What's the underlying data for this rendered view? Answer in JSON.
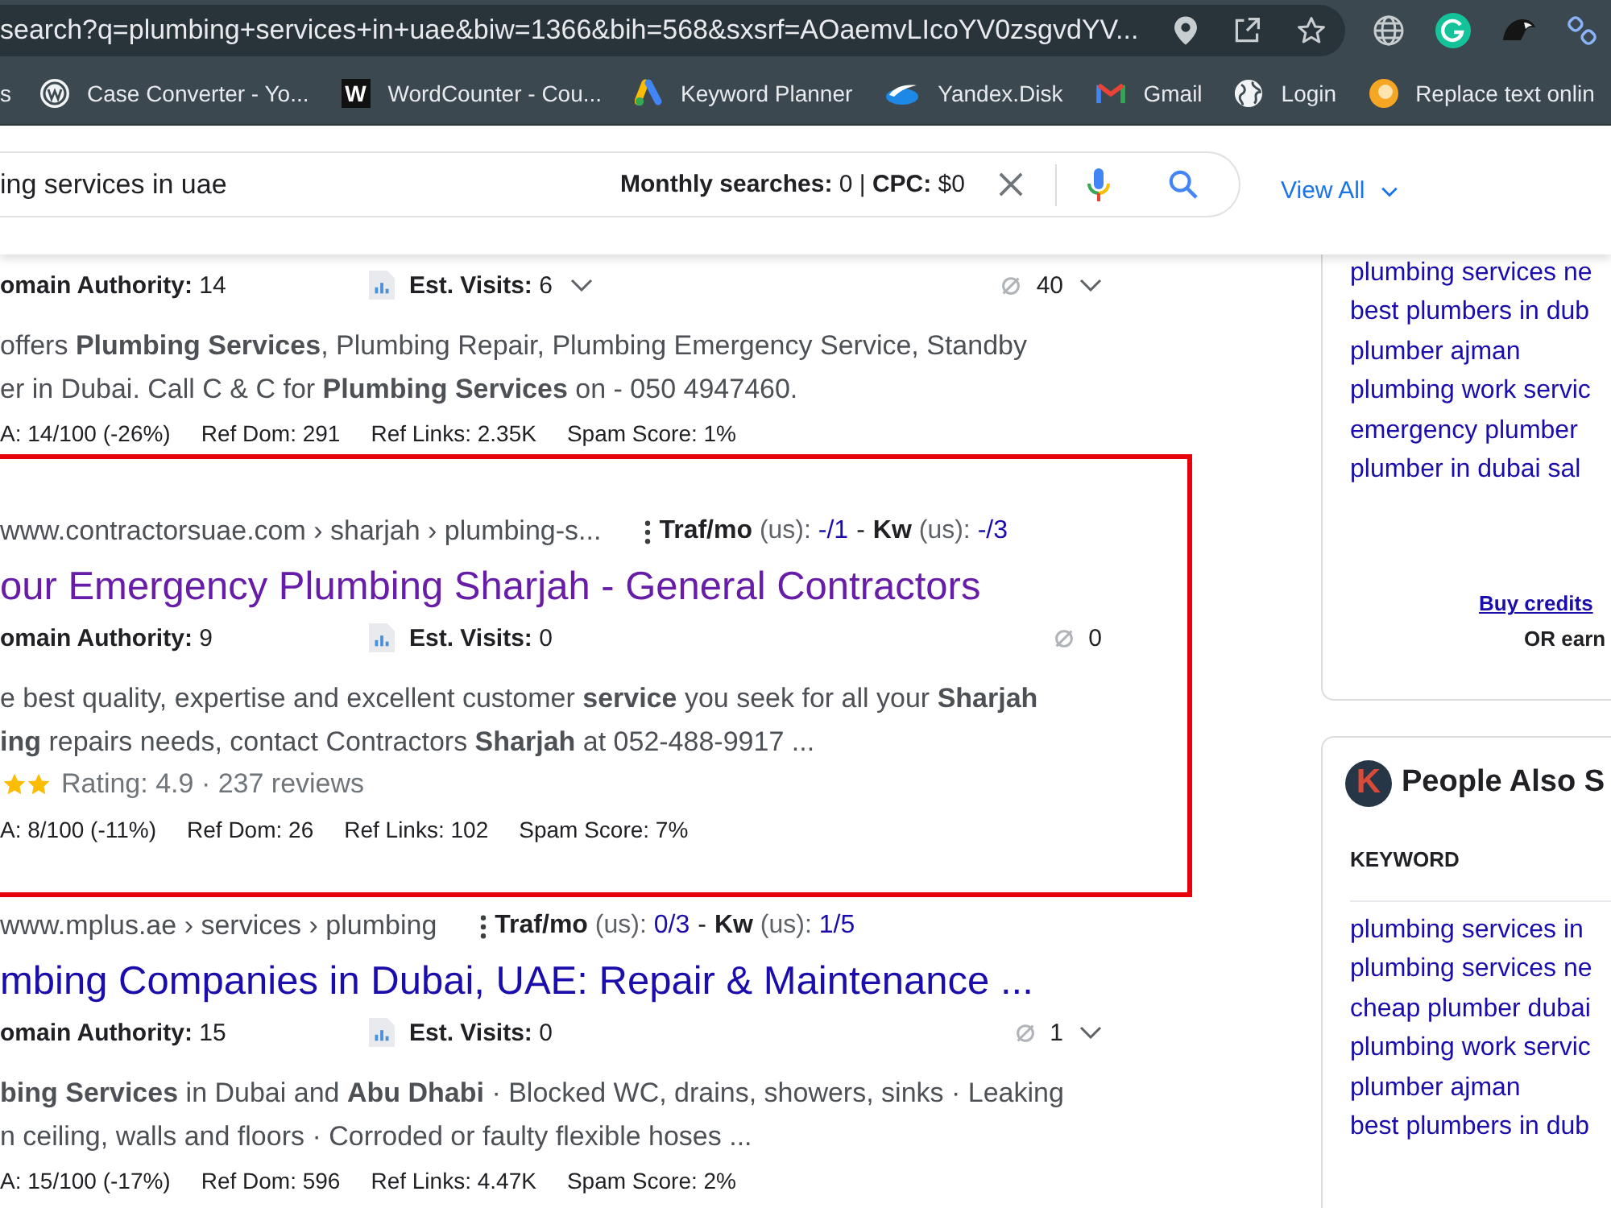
{
  "browser": {
    "url": "search?q=plumbing+services+in+uae&biw=1366&bih=568&sxsrf=AOaemvLIcoYV0zsgvdYV...",
    "bookmarks": [
      {
        "label": "s",
        "kind": "none"
      },
      {
        "label": "Case Converter - Yo...",
        "kind": "wp"
      },
      {
        "label": "WordCounter - Cou...",
        "kind": "tile",
        "glyph": "W"
      },
      {
        "label": "Keyword Planner",
        "kind": "triangle"
      },
      {
        "label": "Yandex.Disk",
        "kind": "swoosh"
      },
      {
        "label": "Gmail",
        "kind": "mail"
      },
      {
        "label": "Login",
        "kind": "globe"
      },
      {
        "label": "Replace text onlin",
        "kind": "orange"
      }
    ]
  },
  "search": {
    "query": "ing services in uae",
    "stats": "**Monthly searches:** 0 | **CPC:** $0",
    "view_all": "View All"
  },
  "results": [
    {
      "highlighted": false,
      "domain_authority": "**omain Authority:** 14",
      "est_visits": "**Est. Visits:** 6",
      "visits_dropdown": true,
      "backlinks": "40",
      "links_dropdown": true,
      "snippet": [
        "offers **Plumbing Services**, Plumbing Repair, Plumbing Emergency Service, Standby",
        "er in Dubai. Call C & C for **Plumbing Services** on - 050 4947460."
      ],
      "metrics": [
        "A: 14/100 (-26%)",
        "Ref Dom: 291",
        "Ref Links: 2.35K",
        "Spam Score: 1%"
      ]
    },
    {
      "highlighted": true,
      "visited": true,
      "url": "www.contractorsuae.com › sharjah › plumbing-s...",
      "traffic": [
        {
          "label": "Traf/mo",
          "unit": "(us):",
          "value": "-/1"
        },
        {
          "label": "Kw",
          "unit": "(us):",
          "value": "-/3"
        }
      ],
      "traffic_separator": "-",
      "title": "our Emergency Plumbing Sharjah - General Contractors",
      "domain_authority": "**omain Authority:** 9",
      "est_visits": "**Est. Visits:** 0",
      "visits_dropdown": false,
      "backlinks": "0",
      "links_dropdown": false,
      "snippet": [
        "e best quality, expertise and excellent customer **service** you seek for all your **Sharjah**",
        "**ing** repairs needs, contact Contractors **Sharjah** at 052-488-9917 ..."
      ],
      "rating": "Rating: 4.9 · 237 reviews",
      "metrics": [
        "A: 8/100 (-11%)",
        "Ref Dom: 26",
        "Ref Links: 102",
        "Spam Score: 7%"
      ]
    },
    {
      "highlighted": false,
      "visited": false,
      "url": "www.mplus.ae › services › plumbing",
      "traffic": [
        {
          "label": "Traf/mo",
          "unit": "(us):",
          "value": "0/3"
        },
        {
          "label": "Kw",
          "unit": "(us):",
          "value": "1/5"
        }
      ],
      "traffic_separator": "-",
      "title": "mbing Companies in Dubai, UAE: Repair & Maintenance ...",
      "domain_authority": "**omain Authority:** 15",
      "est_visits": "**Est. Visits:** 0",
      "visits_dropdown": false,
      "backlinks": "1",
      "links_dropdown": true,
      "snippet": [
        "**bing Services** in Dubai and **Abu Dhabi** · Blocked WC, drains, showers, sinks · Leaking",
        "n ceiling, walls and floors · Corroded or faulty flexible hoses ..."
      ],
      "metrics": [
        "A: 15/100 (-17%)",
        "Ref Dom: 596",
        "Ref Links: 4.47K",
        "Spam Score: 2%"
      ]
    }
  ],
  "sidebar": {
    "related": [
      "plumbing services ne",
      "best plumbers in dub",
      "plumber ajman",
      "plumbing work servic",
      "emergency plumber",
      "plumber in dubai sal"
    ],
    "credits_link": "Buy credits",
    "credits_note": "OR earn",
    "people_also_search": {
      "logo": "K",
      "title": "People Also S",
      "column": "KEYWORD",
      "keywords": [
        "plumbing services in",
        "plumbing services ne",
        "cheap plumber dubai",
        "plumbing work servic",
        "plumber ajman",
        "best plumbers in dub"
      ]
    }
  }
}
